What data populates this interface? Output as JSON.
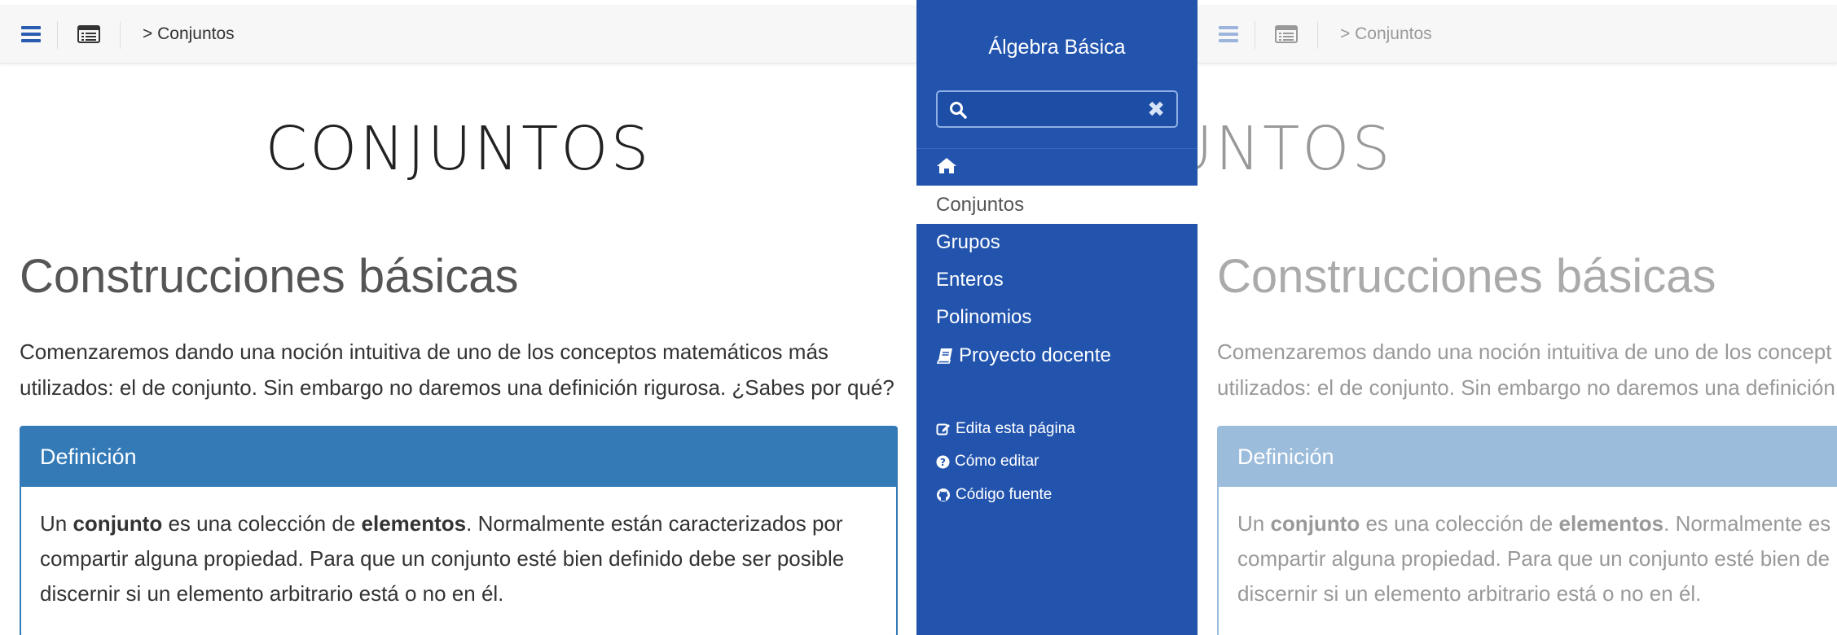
{
  "topbar": {
    "breadcrumb": "> Conjuntos"
  },
  "page": {
    "title": "CONJUNTOS",
    "section_heading": "Construcciones básicas",
    "intro_paragraph_line1": "Comenzaremos dando una noción intuitiva de uno de los conceptos matemáticos más",
    "intro_paragraph_line2": "utilizados: el de conjunto. Sin embargo no daremos una definición rigurosa. ¿Sabes por qué?",
    "definition": {
      "header": "Definición",
      "body_part1": "Un ",
      "body_bold1": "conjunto",
      "body_part2": " es una colección de ",
      "body_bold2": "elementos",
      "body_part3": ". Normalmente están caracterizados por",
      "body_line2": "compartir alguna propiedad. Para que un conjunto esté bien definido debe ser posible",
      "body_line3": "discernir si un elemento arbitrario está o no en él."
    }
  },
  "right_page": {
    "intro_paragraph_line1": "Comenzaremos dando una noción intuitiva de uno de los concept",
    "intro_paragraph_line2": "utilizados: el de conjunto. Sin embargo no daremos una definición",
    "body_part3": ". Normalmente es",
    "body_line2": "compartir alguna propiedad. Para que un conjunto esté bien de"
  },
  "sidebar": {
    "title": "Álgebra Básica",
    "search": {
      "value": "",
      "placeholder": ""
    },
    "items": [
      {
        "label": "Conjuntos",
        "active": true
      },
      {
        "label": "Grupos"
      },
      {
        "label": "Enteros"
      },
      {
        "label": "Polinomios"
      },
      {
        "label": "Proyecto docente"
      }
    ],
    "tools": [
      {
        "label": "Edita esta página",
        "icon": "edit-icon"
      },
      {
        "label": "Cómo editar",
        "icon": "question-circle-icon"
      },
      {
        "label": "Código fuente",
        "icon": "github-icon"
      }
    ]
  },
  "colors": {
    "sidebar_bg": "#2254ae",
    "definition_header": "#337ab7",
    "hamburger": "#2a5db0"
  }
}
